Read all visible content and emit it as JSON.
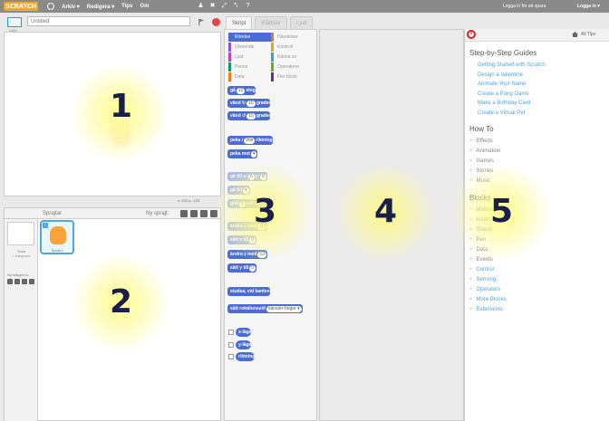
{
  "topbar": {
    "logo": "SCRATCH",
    "menu": [
      "Arkiv ▾",
      "Redigera ▾",
      "Tips",
      "Om"
    ],
    "signin_save": "Logga in för att spara",
    "signin": "Logga in ▾"
  },
  "stage": {
    "title_placeholder": "Untitled",
    "version": "v456",
    "coords": "x: 240  y: -120"
  },
  "sprites": {
    "title": "Sprajtar",
    "new_sprite": "Ny sprajt:",
    "stage_label": "Scen",
    "stage_sub": "1 bakgrund",
    "new_bg": "Ny bakgrund:",
    "sprite_name": "Sprite1",
    "sprite_badge": "i"
  },
  "tabs": [
    "Skript",
    "Klädslar",
    "Ljud"
  ],
  "palette": {
    "categories": [
      "Rörelse",
      "Händelser",
      "Utseende",
      "Kontroll",
      "Ljud",
      "Känna av",
      "Penna",
      "Operatorer",
      "Data",
      "Fler block"
    ],
    "blocks": {
      "b1": "gå",
      "b1v": "10",
      "b1s": "steg",
      "b2": "vänd ↻",
      "b2v": "15",
      "b2s": "grader",
      "b3": "vänd ↺",
      "b3v": "15",
      "b3s": "grader",
      "b4": "peka i",
      "b4v": "90▾",
      "b4s": "riktning",
      "b5": "peka mot",
      "b5v": "▾",
      "b6": "gå till x:",
      "b6v": "0",
      "b6s": "y:",
      "b6w": "0",
      "b7": "gå till",
      "b7v": "▾",
      "b8": "glid",
      "b8v": "1",
      "b8s": "sek till x:",
      "b9": "ändra x med",
      "b9v": "10",
      "b10": "sätt x till",
      "b10v": "0",
      "b11": "ändra y med",
      "b11v": "10",
      "b12": "sätt y till",
      "b12v": "0",
      "b13": "studsa, vid kanten",
      "b14": "sätt rotationsstil",
      "b14v": "vänster-höger ▾",
      "r1": "x-läge",
      "r2": "y-läge",
      "r3": "riktning"
    }
  },
  "tips": {
    "all_tips": "All Tips",
    "close": "×",
    "h1": "Step-by-Step Guides",
    "guides": [
      "Getting Started with Scratch",
      "Design a Valentine",
      "Animate Your Name",
      "Create a Pong Game",
      "Make a Birthday Card",
      "Create a Virtual Pet"
    ],
    "h2": "How To",
    "howto": [
      "Effects",
      "Animation",
      "Games",
      "Stories",
      "Music"
    ],
    "h3": "Blocks",
    "blocks": [
      "Motion",
      "Looks",
      "Sound",
      "Pen",
      "Data",
      "Events",
      "Control",
      "Sensing",
      "Operators",
      "More Blocks",
      "Extensions"
    ]
  },
  "annotations": [
    "1",
    "2",
    "3",
    "4",
    "5"
  ]
}
